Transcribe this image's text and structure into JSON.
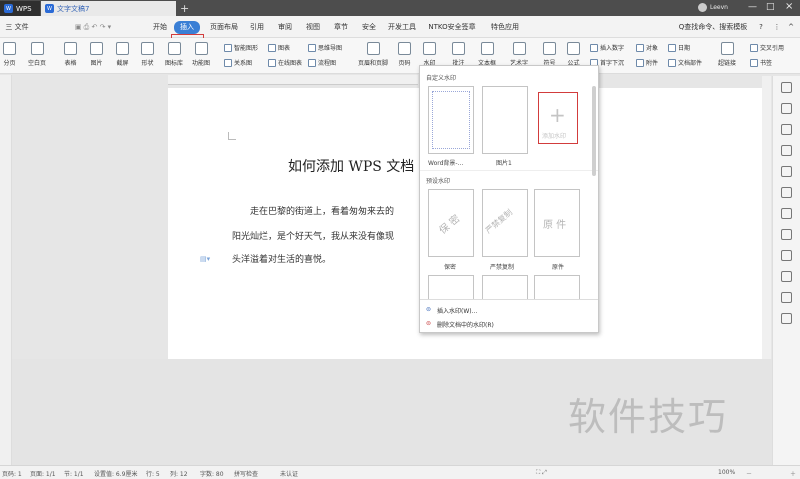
{
  "titlebar": {
    "app_tab": "WPS",
    "doc_tab": "文字文稿7",
    "user": "Leevn"
  },
  "menu": {
    "file": "三 文件",
    "items": [
      "开始",
      "插入",
      "页面布局",
      "引用",
      "审阅",
      "视图",
      "章节",
      "安全",
      "开发工具",
      "NTKO安全签章",
      "特色应用"
    ],
    "search": "Q查找命令、搜索模板",
    "active": "插入"
  },
  "ribbon": {
    "big": [
      "分页",
      "空白页",
      "表格",
      "图片",
      "截屏",
      "形状",
      "图标库",
      "功能图",
      "页眉和页脚",
      "页码",
      "水印",
      "批注",
      "文本框",
      "艺术字",
      "符号",
      "公式",
      "超链接"
    ],
    "small": [
      "智能图形",
      "图表",
      "思维导图",
      "关系图",
      "在线图表",
      "流程图",
      "插入数字",
      "对象",
      "日期",
      "首字下沉",
      "附件",
      "文档部件",
      "交叉引用",
      "书签"
    ]
  },
  "document": {
    "title": "如何添加 WPS 文档",
    "lines": [
      "走在巴黎的街道上，看着匆匆来去的",
      "阳光灿烂，是个好天气，我从来没有像现",
      "头洋溢着对生活的喜悦。"
    ]
  },
  "dropdown": {
    "custom_header": "自定义水印",
    "custom": [
      {
        "label": "Word背景-..."
      },
      {
        "label": "图片1"
      }
    ],
    "add_label": "添加水印",
    "preset_header": "预设水印",
    "presets": [
      {
        "text": "保 密",
        "label": "保密"
      },
      {
        "text": "严禁复制",
        "label": "严禁复制"
      },
      {
        "text": "原 件",
        "label": "原件"
      }
    ],
    "insert": "插入水印(W)...",
    "delete": "删除文档中的水印(R)"
  },
  "watermark_overlay": "软件技巧",
  "status": {
    "page": "页码: 1",
    "pages": "页面: 1/1",
    "section": "节: 1/1",
    "setting": "设置值: 6.9厘米",
    "row": "行: 5",
    "col": "列: 12",
    "words": "字数: 80",
    "spell": "拼写检查",
    "auth": "未认证",
    "zoom": "100%"
  },
  "accent": "#3a7fd5"
}
